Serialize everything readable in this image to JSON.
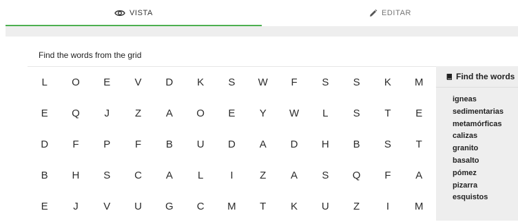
{
  "tabs": [
    {
      "label": "VISTA",
      "icon": "eye-icon",
      "active": true
    },
    {
      "label": "EDITAR",
      "icon": "pencil-icon",
      "active": false
    }
  ],
  "instructions": "Find the words from the grid",
  "grid": [
    [
      "L",
      "O",
      "E",
      "V",
      "D",
      "K",
      "S",
      "W",
      "F",
      "S",
      "S",
      "K",
      "M"
    ],
    [
      "E",
      "Q",
      "J",
      "Z",
      "A",
      "O",
      "E",
      "Y",
      "W",
      "L",
      "S",
      "T",
      "E"
    ],
    [
      "D",
      "F",
      "P",
      "F",
      "B",
      "U",
      "D",
      "A",
      "D",
      "H",
      "B",
      "S",
      "T"
    ],
    [
      "B",
      "H",
      "S",
      "C",
      "A",
      "L",
      "I",
      "Z",
      "A",
      "S",
      "Q",
      "F",
      "A"
    ],
    [
      "E",
      "J",
      "V",
      "U",
      "G",
      "C",
      "M",
      "T",
      "K",
      "U",
      "Z",
      "I",
      "M"
    ]
  ],
  "sidebar": {
    "title": "Find the words",
    "icon": "book-icon",
    "words": [
      "igneas",
      "sedimentarias",
      "metamórficas",
      "calizas",
      "granito",
      "basalto",
      "pómez",
      "pizarra",
      "esquistos"
    ]
  },
  "colors": {
    "accent": "#4caf50",
    "panel": "#eeeeee"
  }
}
